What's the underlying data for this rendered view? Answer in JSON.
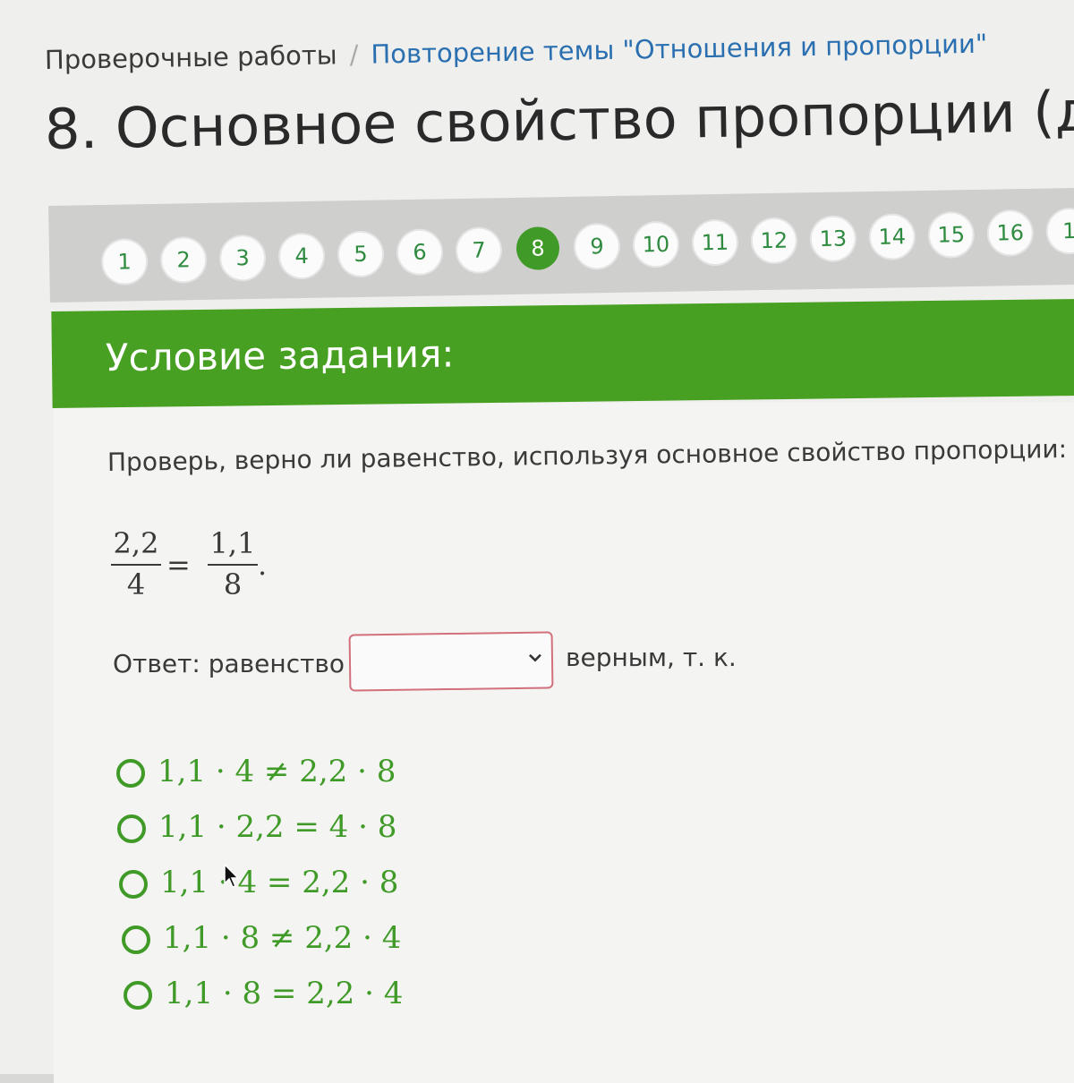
{
  "breadcrumb": {
    "parent": "Проверочные работы",
    "separator": "/",
    "current": "Повторение темы \"Отношения и пропорции\""
  },
  "page_title": "8. Основное свойство пропорции (д",
  "pager": {
    "items": [
      "1",
      "2",
      "3",
      "4",
      "5",
      "6",
      "7",
      "8",
      "9",
      "10",
      "11",
      "12",
      "13",
      "14",
      "15",
      "16",
      "1"
    ],
    "current": "8"
  },
  "task": {
    "header": "Условие задания:",
    "instruction": "Проверь, верно ли равенство, используя основное свойство пропорции:",
    "equation": {
      "left": {
        "numerator": "2,2",
        "denominator": "4"
      },
      "sign": "=",
      "right": {
        "numerator": "1,1",
        "denominator": "8"
      },
      "end": "."
    },
    "answer": {
      "label": "Ответ: равенство",
      "select_value": "",
      "suffix": "верным, т. к."
    },
    "options": [
      "1,1 · 4 ≠ 2,2 · 8",
      "1,1 · 2,2 = 4 · 8",
      "1,1 · 4 = 2,2 · 8",
      "1,1 · 8 ≠ 2,2 · 4",
      "1,1 · 8 = 2,2 · 4"
    ]
  },
  "colors": {
    "accent_green": "#47a021",
    "link_blue": "#2a6fb0",
    "select_border": "#d2707c"
  }
}
